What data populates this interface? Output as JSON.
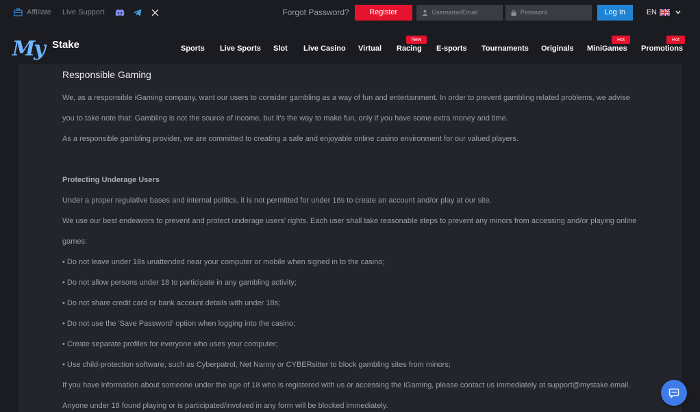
{
  "topbar": {
    "affiliate": "Affiliate",
    "live_support": "Live Support",
    "social_icons": [
      "discord-icon",
      "telegram-icon",
      "x-icon"
    ],
    "forgot_password": "Forgot Password?",
    "register": "Register",
    "username_placeholder": "Username/Email",
    "password_placeholder": "Password",
    "login": "Log In",
    "language": "EN"
  },
  "logo": {
    "my": "My",
    "stake": "Stake"
  },
  "nav": {
    "items": [
      {
        "label": "Sports"
      },
      {
        "label": "Live Sports"
      },
      {
        "label": "Slot"
      },
      {
        "label": "Live Casino"
      },
      {
        "label": "Virtual"
      },
      {
        "label": "Racing",
        "badge": "New"
      },
      {
        "label": "E-sports"
      },
      {
        "label": "Tournaments"
      },
      {
        "label": "Originals"
      },
      {
        "label": "MiniGames",
        "badge": "Hot"
      },
      {
        "label": "Promotions",
        "badge": "Hot"
      }
    ]
  },
  "content": {
    "title": "Responsible Gaming",
    "lines": [
      "We, as a responsible iGaming company, want our users to consider gambling as a way of fun and entertainment.  In order to prevent gambling related problems, we advise",
      "you to take note that: Gambling is not the source of income, but it's the way to make fun, only if you have some extra money and time.",
      "As a responsible gambling provider, we are committed to creating a safe and enjoyable online casino environment for our valued players.",
      "Protecting Underage Users",
      "Under a proper regulative bases and internal politics, it is not permitted for under 18s to create an account and/or play at our site.",
      "We use our best endeavors to prevent and protect underage users' rights. Each user shall take reasonable steps to prevent any minors from accessing and/or playing online",
      "games:",
      "• Do not leave under 18s unattended near your computer or mobile when signed in to the casino;",
      "• Do not allow persons under 18 to participate in any gambling activity;",
      "• Do not share credit card or bank account details with under 18s;",
      "• Do not use the 'Save Password' option when logging into the casino;",
      "• Create separate profiles for everyone who uses your computer;",
      "• Use child-protection software, such as Cyberpatrol, Net Nanny or CYBERsitter to block gambling sites from minors;",
      "If you have information about someone under the age of 18 who is registered with us or accessing the iGaming, please contact us immediately at support@mystake.email.",
      "Anyone under 18 found playing or is participated/involved in any form will be blocked immediately."
    ]
  },
  "colors": {
    "accent_red": "#e7132e",
    "accent_blue": "#1f84d6",
    "background": "#1b1c21",
    "panel": "#24252c"
  }
}
